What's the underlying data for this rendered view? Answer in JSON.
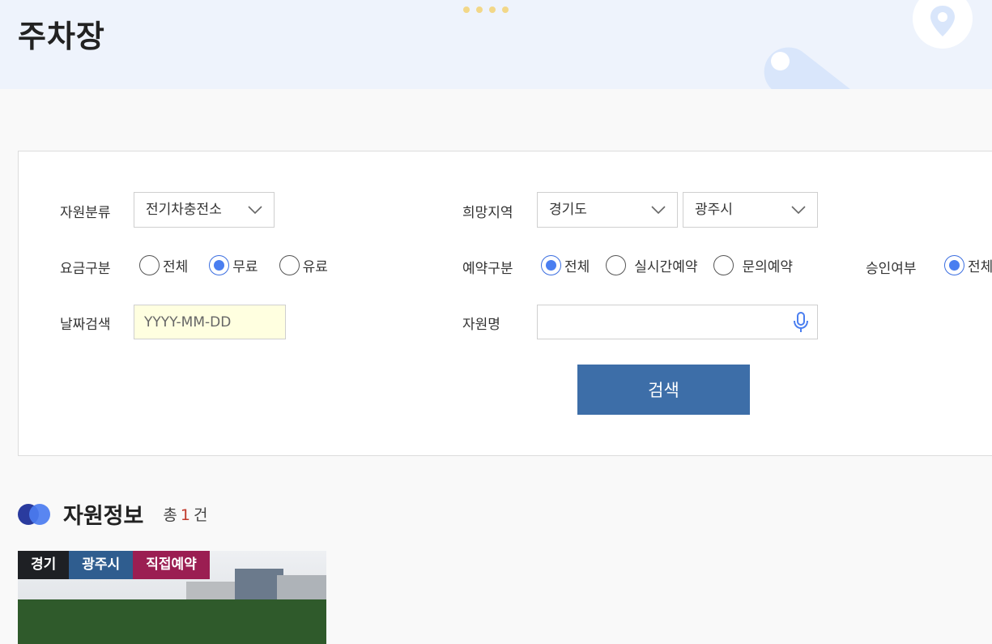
{
  "hero": {
    "title": "주차장"
  },
  "filters": {
    "resource_type": {
      "label": "자원분류",
      "value": "전기차충전소"
    },
    "region": {
      "label": "희망지역",
      "province": "경기도",
      "city": "광주시"
    },
    "fee": {
      "label": "요금구분",
      "options": [
        "전체",
        "무료",
        "유료"
      ],
      "selected": "무료"
    },
    "reservation": {
      "label": "예약구분",
      "options": [
        "전체",
        "실시간예약",
        "문의예약"
      ],
      "selected": "전체"
    },
    "approval": {
      "label": "승인여부",
      "options": [
        "전체"
      ],
      "selected": "전체"
    },
    "date": {
      "label": "날짜검색",
      "placeholder": "YYYY-MM-DD"
    },
    "name": {
      "label": "자원명",
      "placeholder": ""
    },
    "search_label": "검색"
  },
  "results": {
    "title": "자원정보",
    "total_prefix": "총",
    "count": "1",
    "total_suffix": "건",
    "cards": [
      {
        "tags": [
          {
            "text": "경기",
            "color": "#1e2024"
          },
          {
            "text": "광주시",
            "color": "#2f5d8f"
          },
          {
            "text": "직접예약",
            "color": "#9b1e52"
          }
        ]
      }
    ]
  },
  "colors": {
    "accent": "#3d6ea8",
    "radio": "#4a7ef0",
    "count": "#c0392b"
  }
}
